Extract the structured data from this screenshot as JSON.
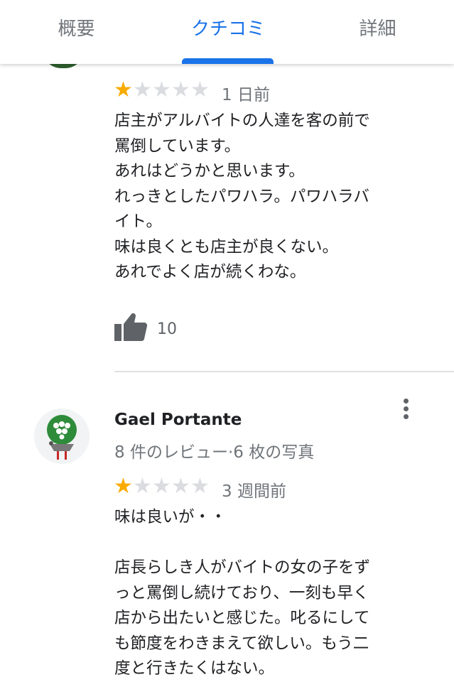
{
  "tabs": [
    {
      "label": "概要"
    },
    {
      "label": "クチコミ"
    },
    {
      "label": "詳細"
    }
  ],
  "colors": {
    "accent": "#1a73e8",
    "star": "#f9ab00",
    "star_empty": "#dadce0",
    "muted": "#70757a"
  },
  "reviews": [
    {
      "rating": 1,
      "time": "1 日前",
      "lines": [
        "店主がアルバイトの人達を客の前で",
        "罵倒しています。",
        "あれはどうかと思います。",
        "れっきとしたパワハラ。パワハラバ",
        "イト。",
        "味は良くとも店主が良くない。",
        "あれでよく店が続くわな。"
      ],
      "likes": "10",
      "icons": {
        "like": "thumbs-up-icon"
      }
    },
    {
      "author": "Gael Portante",
      "stats": "8 件のレビュー·6 枚の写真",
      "rating": 1,
      "time": "3 週間前",
      "lines": [
        "味は良いが・・",
        "",
        "店長らしき人がバイトの女の子をず",
        "っと罵倒し続けており、一刻も早く",
        "店から出たいと感じた。叱るにして",
        "も節度をわきまえて欲しい。もう二",
        "度と行きたくはない。"
      ],
      "icons": {
        "more": "more-vert-icon",
        "avatar": "avatar"
      }
    }
  ]
}
